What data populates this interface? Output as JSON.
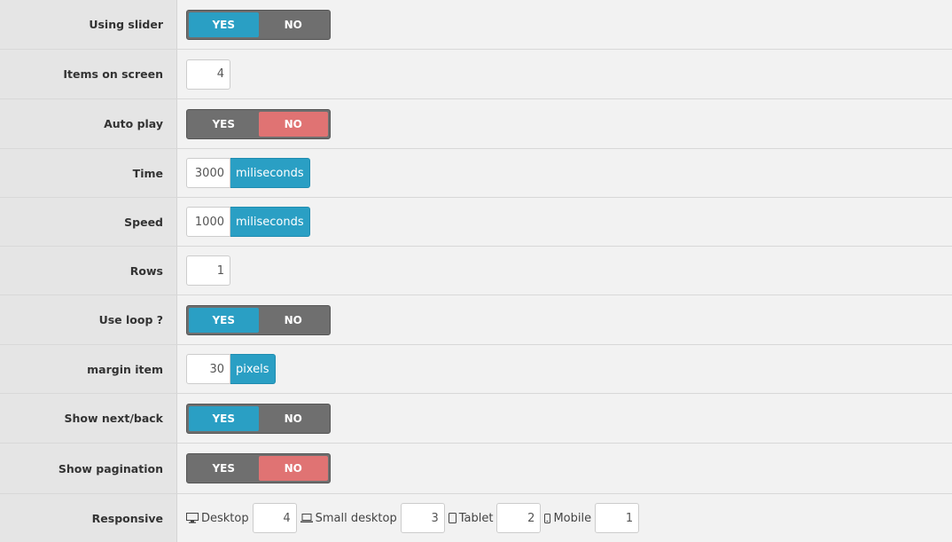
{
  "rows": {
    "using_slider": {
      "label": "Using slider",
      "yes": "YES",
      "no": "NO",
      "selected": "yes"
    },
    "items_on_screen": {
      "label": "Items on screen",
      "value": "4"
    },
    "auto_play": {
      "label": "Auto play",
      "yes": "YES",
      "no": "NO",
      "selected": "no"
    },
    "time": {
      "label": "Time",
      "value": "3000",
      "unit": "miliseconds"
    },
    "speed": {
      "label": "Speed",
      "value": "1000",
      "unit": "miliseconds"
    },
    "rows_count": {
      "label": "Rows",
      "value": "1"
    },
    "use_loop": {
      "label": "Use loop ?",
      "yes": "YES",
      "no": "NO",
      "selected": "yes"
    },
    "margin_item": {
      "label": "margin item",
      "value": "30",
      "unit": "pixels"
    },
    "show_next_back": {
      "label": "Show next/back",
      "yes": "YES",
      "no": "NO",
      "selected": "yes"
    },
    "show_pagination": {
      "label": "Show pagination",
      "yes": "YES",
      "no": "NO",
      "selected": "no"
    },
    "responsive": {
      "label": "Responsive",
      "desktop": {
        "label": "Desktop",
        "value": "4",
        "icon": "desktop-icon"
      },
      "small_desktop": {
        "label": "Small desktop",
        "value": "3",
        "icon": "laptop-icon"
      },
      "tablet": {
        "label": "Tablet",
        "value": "2",
        "icon": "tablet-icon"
      },
      "mobile": {
        "label": "Mobile",
        "value": "1",
        "icon": "mobile-icon"
      }
    }
  },
  "colors": {
    "yes_active": "#2a9fc4",
    "no_active": "#e07373",
    "toggle_bg": "#6f6f6f",
    "addon": "#2a9fc4"
  }
}
